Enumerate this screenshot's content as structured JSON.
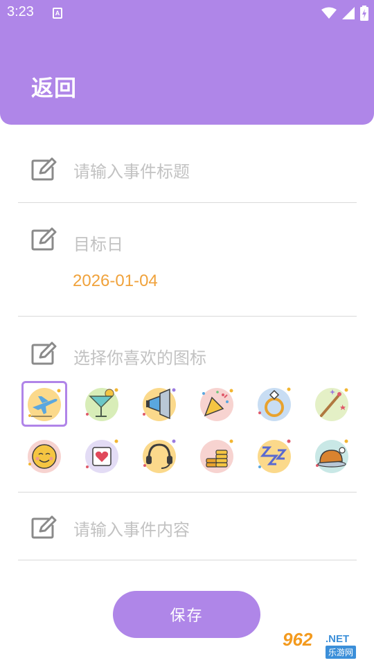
{
  "status_bar": {
    "time": "3:23",
    "notification_glyph": "A",
    "icons": [
      "wifi-icon",
      "signal-icon",
      "battery-icon"
    ]
  },
  "header": {
    "back_label": "返回",
    "background_color": "#af86e8"
  },
  "form": {
    "title_placeholder": "请输入事件标题",
    "target_date_label": "目标日",
    "target_date_value": "2026-01-04",
    "icon_picker_label": "选择你喜欢的图标",
    "content_placeholder": "请输入事件内容"
  },
  "icon_options": [
    {
      "name": "airplane",
      "selected": true
    },
    {
      "name": "cocktail",
      "selected": false
    },
    {
      "name": "megaphone",
      "selected": false
    },
    {
      "name": "party-popper",
      "selected": false
    },
    {
      "name": "ring",
      "selected": false
    },
    {
      "name": "magic-wand",
      "selected": false
    },
    {
      "name": "smiley",
      "selected": false
    },
    {
      "name": "heart-card",
      "selected": false
    },
    {
      "name": "headphones",
      "selected": false
    },
    {
      "name": "coins",
      "selected": false
    },
    {
      "name": "sleep-zzz",
      "selected": false
    },
    {
      "name": "roast-chicken",
      "selected": false
    }
  ],
  "save_button": {
    "label": "保存"
  },
  "watermark": {
    "main": "962",
    "domain": ".NET",
    "sub": "乐游网"
  },
  "colors": {
    "accent": "#af86e8",
    "date": "#f0a23b",
    "placeholder": "#c2c2c2",
    "divider": "#d9d9d9"
  }
}
